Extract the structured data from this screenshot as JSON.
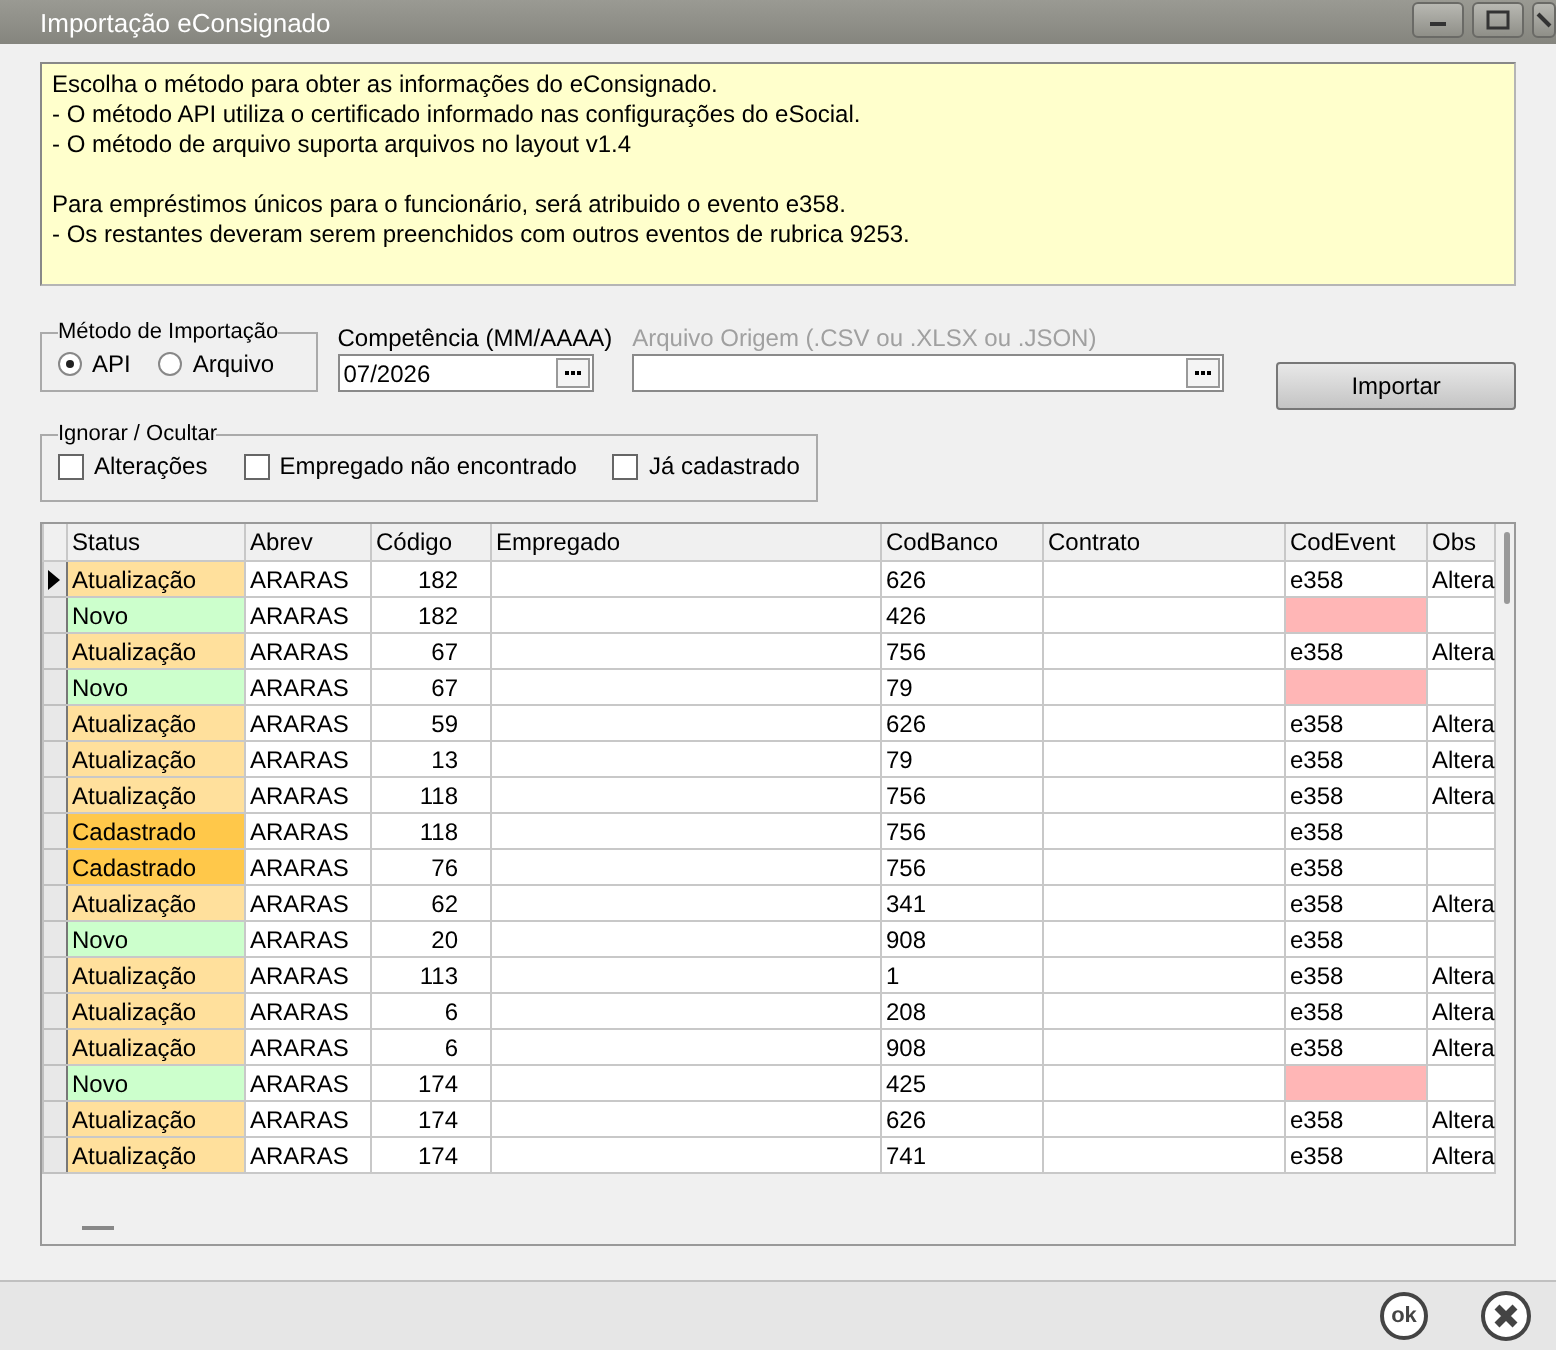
{
  "window": {
    "title": "Importação eConsignado"
  },
  "info": {
    "paragraphs": [
      [
        "Escolha o método para obter as informações do eConsignado.",
        "- O método API utiliza o certificado informado nas configurações do eSocial.",
        "- O método de arquivo suporta arquivos no layout v1.4"
      ],
      [
        "Para empréstimos únicos para o funcionário, será atribuido o evento e358.",
        "- Os restantes deveram serem preenchidos com outros eventos de rubrica 9253."
      ]
    ]
  },
  "import_method": {
    "label": "Método de Importação",
    "options": [
      {
        "label": "API",
        "selected": true
      },
      {
        "label": "Arquivo",
        "selected": false
      }
    ]
  },
  "competencia": {
    "label": "Competência (MM/AAAA)",
    "value": "07/2026"
  },
  "arquivo": {
    "label": "Arquivo Origem (.CSV ou .XLSX ou .JSON)",
    "disabled": true
  },
  "import_button": "Importar",
  "ignore": {
    "label": "Ignorar / Ocultar",
    "options": [
      {
        "label": "Alterações",
        "checked": false
      },
      {
        "label": "Empregado não encontrado",
        "checked": false
      },
      {
        "label": "Já cadastrado",
        "checked": false
      }
    ]
  },
  "table": {
    "columns": [
      "Status",
      "Abrev",
      "Código",
      "Empregado",
      "CodBanco",
      "Contrato",
      "CodEvent",
      "Obs"
    ],
    "rows": [
      {
        "selected": true,
        "status": "Atualização",
        "color": "#ffe09c",
        "abrev": "ARARAS",
        "codigo": "182",
        "codbanco": "626",
        "codevent": "e358",
        "event_missing": false,
        "obs": "Altera"
      },
      {
        "selected": false,
        "status": "Novo",
        "color": "#ccffcc",
        "abrev": "ARARAS",
        "codigo": "182",
        "codbanco": "426",
        "event_missing": true
      },
      {
        "selected": false,
        "status": "Atualização",
        "color": "#ffe09c",
        "abrev": "ARARAS",
        "codigo": "67",
        "codbanco": "756",
        "codevent": "e358",
        "event_missing": false,
        "obs": "Altera"
      },
      {
        "selected": false,
        "status": "Novo",
        "color": "#ccffcc",
        "abrev": "ARARAS",
        "codigo": "67",
        "codbanco": "79",
        "event_missing": true
      },
      {
        "selected": false,
        "status": "Atualização",
        "color": "#ffe09c",
        "abrev": "ARARAS",
        "codigo": "59",
        "codbanco": "626",
        "codevent": "e358",
        "event_missing": false,
        "obs": "Altera"
      },
      {
        "selected": false,
        "status": "Atualização",
        "color": "#ffe09c",
        "abrev": "ARARAS",
        "codigo": "13",
        "codbanco": "79",
        "codevent": "e358",
        "event_missing": false,
        "obs": "Altera"
      },
      {
        "selected": false,
        "status": "Atualização",
        "color": "#ffe09c",
        "abrev": "ARARAS",
        "codigo": "118",
        "codbanco": "756",
        "codevent": "e358",
        "event_missing": false,
        "obs": "Altera"
      },
      {
        "selected": false,
        "status": "Cadastrado",
        "color": "#ffc84a",
        "abrev": "ARARAS",
        "codigo": "118",
        "codbanco": "756",
        "codevent": "e358",
        "event_missing": false
      },
      {
        "selected": false,
        "status": "Cadastrado",
        "color": "#ffc84a",
        "abrev": "ARARAS",
        "codigo": "76",
        "codbanco": "756",
        "codevent": "e358",
        "event_missing": false
      },
      {
        "selected": false,
        "status": "Atualização",
        "color": "#ffe09c",
        "abrev": "ARARAS",
        "codigo": "62",
        "codbanco": "341",
        "codevent": "e358",
        "event_missing": false,
        "obs": "Altera"
      },
      {
        "selected": false,
        "status": "Novo",
        "color": "#ccffcc",
        "abrev": "ARARAS",
        "codigo": "20",
        "codbanco": "908",
        "codevent": "e358",
        "event_missing": false
      },
      {
        "selected": false,
        "status": "Atualização",
        "color": "#ffe09c",
        "abrev": "ARARAS",
        "codigo": "113",
        "codbanco": "1",
        "codevent": "e358",
        "event_missing": false,
        "obs": "Altera"
      },
      {
        "selected": false,
        "status": "Atualização",
        "color": "#ffe09c",
        "abrev": "ARARAS",
        "codigo": "6",
        "codbanco": "208",
        "codevent": "e358",
        "event_missing": false,
        "obs": "Altera"
      },
      {
        "selected": false,
        "status": "Atualização",
        "color": "#ffe09c",
        "abrev": "ARARAS",
        "codigo": "6",
        "codbanco": "908",
        "codevent": "e358",
        "event_missing": false,
        "obs": "Altera"
      },
      {
        "selected": false,
        "status": "Novo",
        "color": "#ccffcc",
        "abrev": "ARARAS",
        "codigo": "174",
        "codbanco": "425",
        "event_missing": true
      },
      {
        "selected": false,
        "status": "Atualização",
        "color": "#ffe09c",
        "abrev": "ARARAS",
        "codigo": "174",
        "codbanco": "626",
        "codevent": "e358",
        "event_missing": false,
        "obs": "Altera"
      },
      {
        "selected": false,
        "status": "Atualização",
        "color": "#ffe09c",
        "abrev": "ARARAS",
        "codigo": "174",
        "codbanco": "741",
        "codevent": "e358",
        "event_missing": false,
        "obs": "Altera"
      }
    ]
  },
  "footer": {
    "ok_button": "ok"
  }
}
